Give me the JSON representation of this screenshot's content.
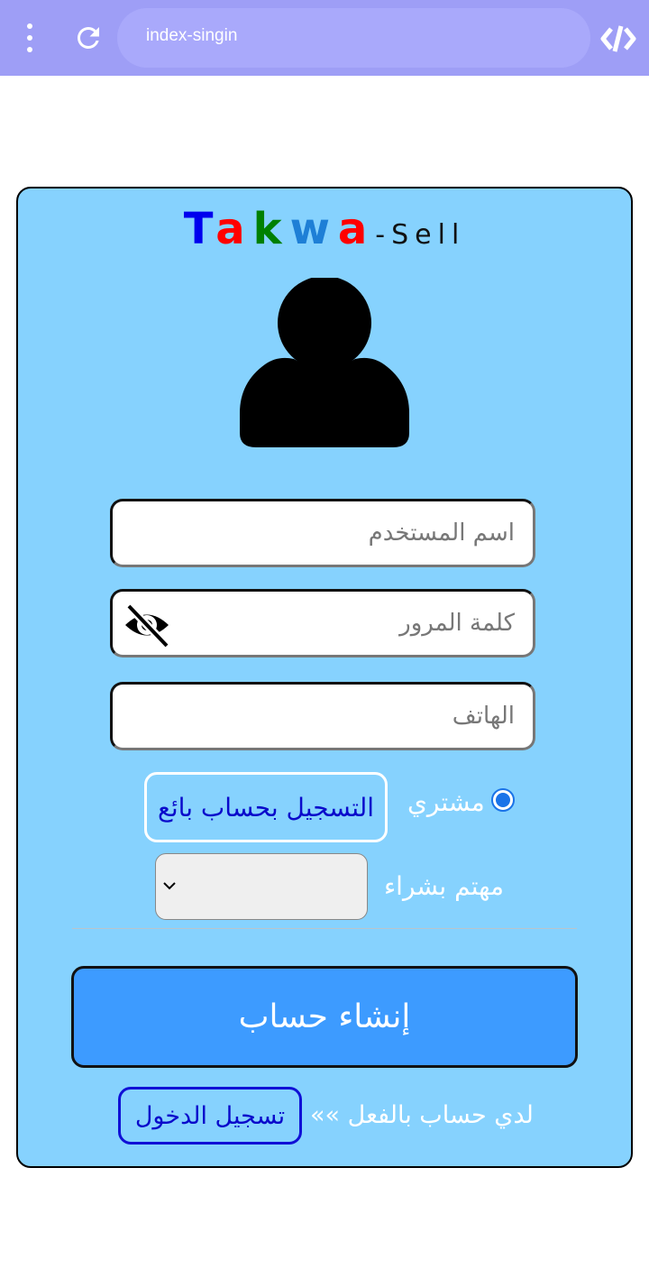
{
  "browser": {
    "url": "index-singin",
    "menu_icon": "more-vert-icon",
    "reload_icon": "reload-icon",
    "code_icon": "code-icon"
  },
  "brand": {
    "letters": [
      {
        "char": "T",
        "color": "#0000ee"
      },
      {
        "char": "a",
        "color": "#ff0000"
      },
      {
        "char": "k",
        "color": "#008000"
      },
      {
        "char": "w",
        "color": "#1e7fd6"
      },
      {
        "char": "a",
        "color": "#ff0000"
      }
    ],
    "suffix": "-Sell"
  },
  "form": {
    "username_placeholder": "اسم المستخدم",
    "password_placeholder": "كلمة المرور",
    "phone_placeholder": "الهاتف",
    "buyer_label": "مشتري",
    "seller_button": "التسجيل بحساب بائع",
    "interest_label": "مهتم بشراء",
    "interest_value": "",
    "create_button": "إنشاء حساب",
    "have_account_text": "لدي حساب بالفعل »»",
    "login_button": "تسجيل الدخول"
  },
  "colors": {
    "topbar": "#9e9ef6",
    "card": "#86d2fe",
    "primary_button": "#3d9bff",
    "link": "#0a0acb"
  }
}
